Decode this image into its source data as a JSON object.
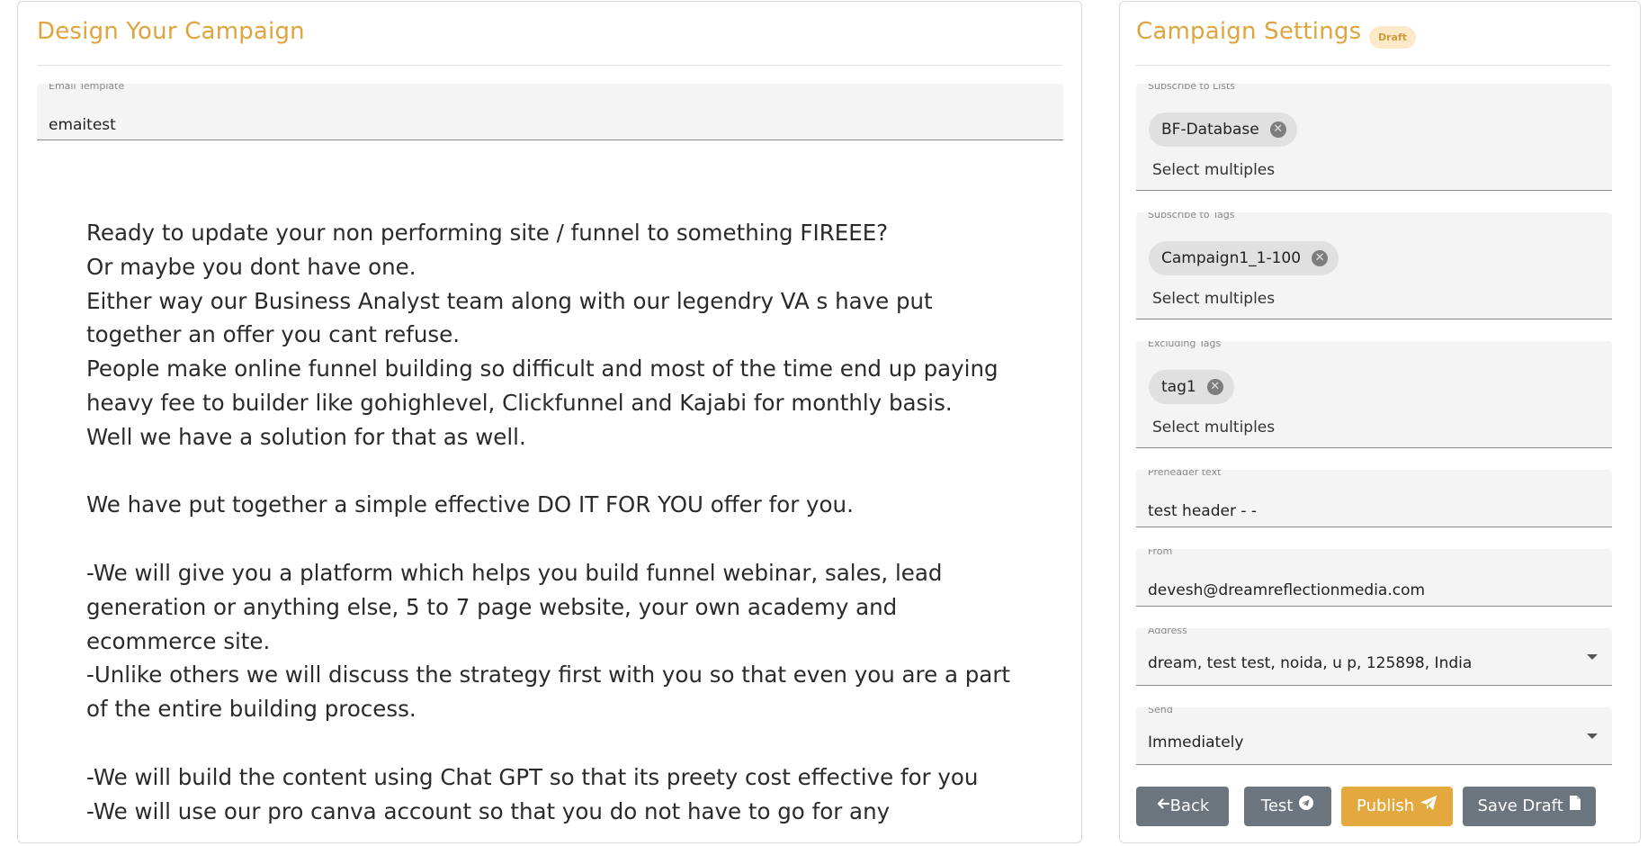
{
  "design": {
    "title": "Design Your Campaign",
    "template_field": {
      "label": "Email Template",
      "value": "emaitest"
    },
    "email_lines": [
      "Ready to update your non performing site / funnel to something FIREEE?",
      "Or maybe you dont have one.",
      "Either way our Business Analyst team along with our legendry VA s have put",
      "together an offer you cant refuse.",
      "People make online funnel building so difficult and most of the time end up paying",
      "heavy fee to builder like gohighlevel, Clickfunnel and Kajabi for monthly basis.",
      "Well we have a solution for that as well.",
      "",
      "We have put together a simple effective DO IT FOR YOU offer for you.",
      "",
      "-We will give you a platform which helps you build funnel webinar, sales, lead",
      "generation or anything else, 5 to 7 page website, your own academy and",
      "ecommerce site.",
      "-Unlike others we will discuss the strategy first with you so that even you are a part",
      "of the entire building process.",
      "",
      "-We will build the content using Chat GPT so that its preety cost effective for you",
      "-We will use our pro canva account so that you do not have to go for any"
    ]
  },
  "settings": {
    "title": "Campaign Settings",
    "status_badge": "Draft",
    "lists": {
      "label": "Subscribe to Lists",
      "chip": "BF-Database",
      "placeholder": "Select multiples"
    },
    "tags": {
      "label": "Subscribe to Tags",
      "chip": "Campaign1_1-100",
      "placeholder": "Select multiples"
    },
    "excluding_tags": {
      "label": "Excluding Tags",
      "chip": "tag1",
      "placeholder": "Select multiples"
    },
    "preheader": {
      "label": "Preheader text",
      "value": "test header -  -"
    },
    "from": {
      "label": "From",
      "value": "devesh@dreamreflectionmedia.com"
    },
    "address": {
      "label": "Address",
      "value": "dream, test test, noida, u p, 125898, India"
    },
    "send": {
      "label": "Send",
      "value": "Immediately"
    },
    "buttons": {
      "back": "Back",
      "test": "Test",
      "publish": "Publish",
      "save_draft": "Save Draft"
    }
  },
  "colors": {
    "accent": "#e0a43c",
    "button_grey": "#6c757d",
    "button_gold": "#e3a93f",
    "badge_bg": "#fbe9c8"
  }
}
